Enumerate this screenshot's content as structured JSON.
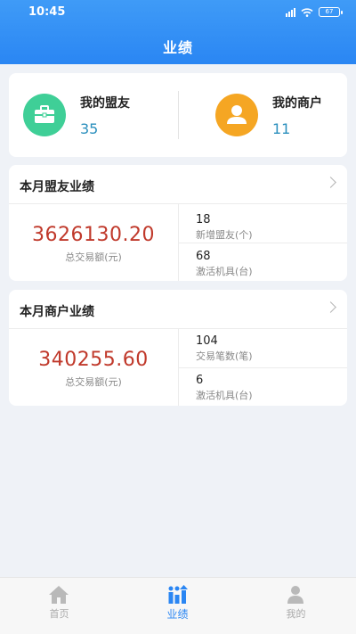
{
  "status": {
    "time": "10:45",
    "battery": "67"
  },
  "header": {
    "title": "业绩"
  },
  "summary": {
    "allies": {
      "label": "我的盟友",
      "value": "35",
      "icon": "toolbox-icon",
      "color": "#3fcf97"
    },
    "merchants": {
      "label": "我的商户",
      "value": "11",
      "icon": "person-icon",
      "color": "#f5a623"
    }
  },
  "ally_perf": {
    "title": "本月盟友业绩",
    "total": "3626130.20",
    "total_label": "总交易额(元)",
    "stat1_value": "18",
    "stat1_label": "新增盟友(个)",
    "stat2_value": "68",
    "stat2_label": "激活机具(台)"
  },
  "merchant_perf": {
    "title": "本月商户业绩",
    "total": "340255.60",
    "total_label": "总交易额(元)",
    "stat1_value": "104",
    "stat1_label": "交易笔数(笔)",
    "stat2_value": "6",
    "stat2_label": "激活机具(台)"
  },
  "tabs": [
    {
      "label": "首页",
      "icon": "home-icon"
    },
    {
      "label": "业绩",
      "icon": "chart-icon",
      "active": true
    },
    {
      "label": "我的",
      "icon": "user-icon"
    }
  ],
  "colors": {
    "accent": "#2a86f3",
    "amount": "#c0392b",
    "count": "#2a8fbd"
  }
}
